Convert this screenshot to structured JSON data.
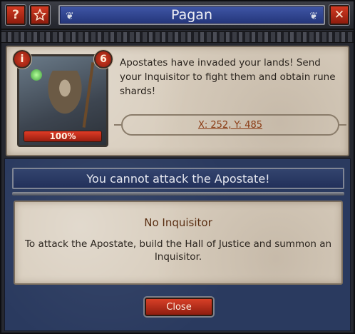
{
  "window": {
    "title": "Pagan"
  },
  "titlebar": {
    "help_label": "?",
    "favorite_icon": "star-icon",
    "close_icon": "close-icon",
    "close_glyph": "✕",
    "accent": "#2f44a0",
    "button_color": "#c2321c"
  },
  "monster": {
    "info_badge": "i",
    "level": "6",
    "health": "100%",
    "health_fraction": 1.0,
    "description": "Apostates have invaded your lands! Send your Inquisitor to fight them and obtain rune shards!",
    "coordinates": "X: 252, Y: 485"
  },
  "attack": {
    "banner": "You cannot attack the Apostate!",
    "reason_title": "No Inquisitor",
    "reason_body": "To attack the Apostate, build the Hall of Justice and summon an Inquisitor.",
    "close_label": "Close"
  }
}
